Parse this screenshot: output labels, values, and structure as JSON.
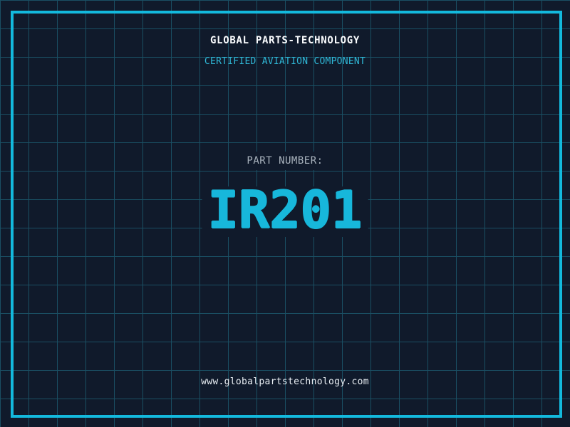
{
  "header": {
    "title": "GLOBAL PARTS-TECHNOLOGY",
    "subtitle": "CERTIFIED AVIATION COMPONENT"
  },
  "part": {
    "label": "PART NUMBER:",
    "number": "IR201"
  },
  "footer": {
    "website": "www.globalpartstechnology.com"
  },
  "colors": {
    "background": "#101a2b",
    "grid_line": "#1a4f63",
    "frame": "#13b9dd",
    "title_text": "#fafcfe",
    "subtitle_text": "#2fb7d6",
    "part_label_text": "#a9b3bd",
    "part_number_text": "#17b7db",
    "footer_text": "#e9eef3"
  }
}
